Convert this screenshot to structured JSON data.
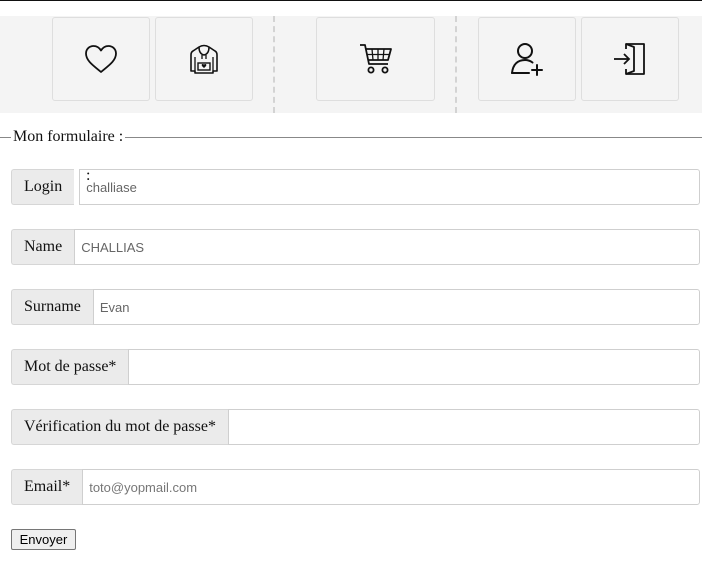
{
  "nav": {
    "buttons": [
      {
        "icon": "heart-icon"
      },
      {
        "icon": "hoodie-icon"
      },
      {
        "icon": "cart-icon"
      },
      {
        "icon": "add-user-icon"
      },
      {
        "icon": "login-icon"
      }
    ]
  },
  "form": {
    "legend": "Mon formulaire :",
    "login": {
      "label": "Login",
      "value": "challiase",
      "colon": ":"
    },
    "name": {
      "label": "Name",
      "value": "CHALLIAS"
    },
    "surname": {
      "label": "Surname",
      "value": "Evan"
    },
    "password": {
      "label": "Mot de passe*",
      "value": ""
    },
    "password_check": {
      "label": "Vérification du mot de passe*",
      "value": ""
    },
    "email": {
      "label": "Email*",
      "placeholder": "toto@yopmail.com"
    },
    "submit_label": "Envoyer"
  },
  "colors": {
    "nav_bg": "#f4f4f4",
    "addon_bg": "#ebebeb",
    "border": "#d6d6d6"
  }
}
